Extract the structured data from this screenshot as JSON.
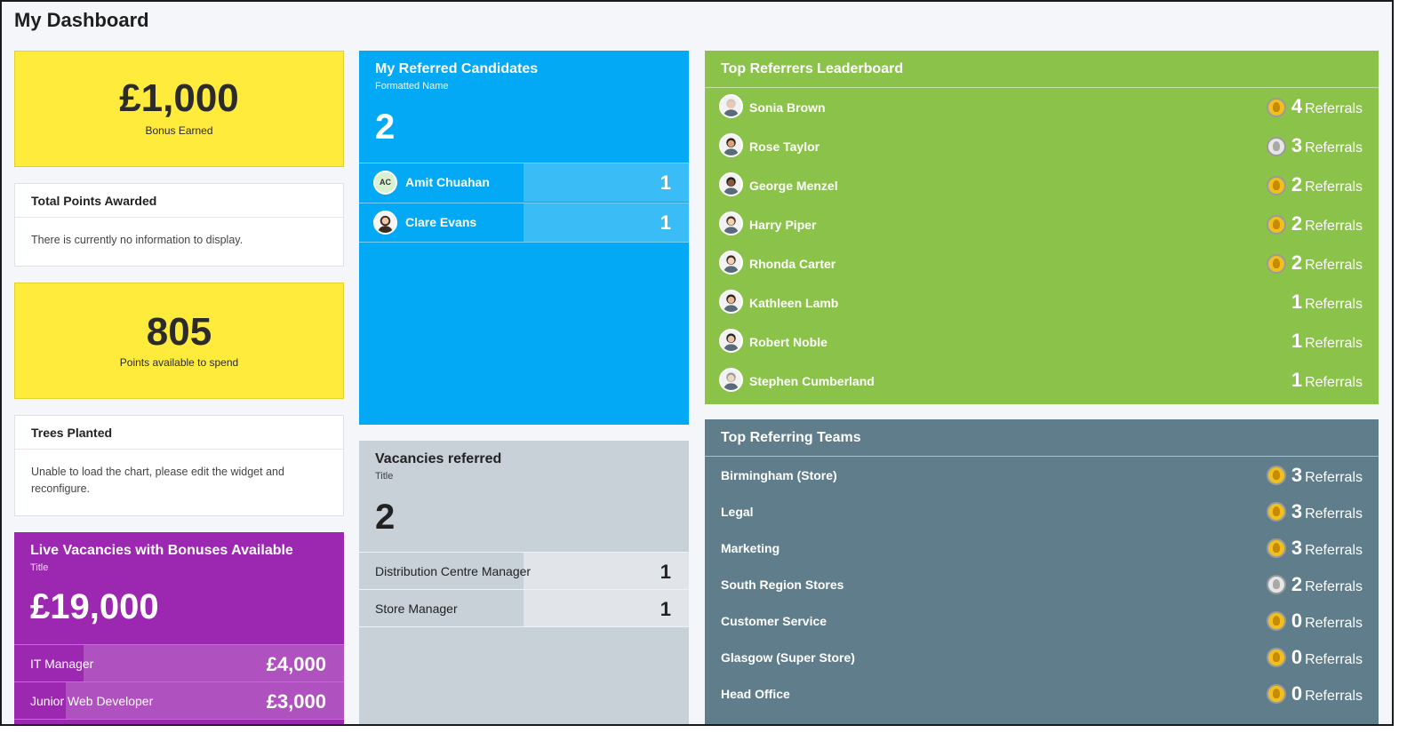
{
  "page": {
    "title": "My Dashboard"
  },
  "bonus": {
    "value": "£1,000",
    "label": "Bonus Earned"
  },
  "total_points": {
    "title": "Total Points Awarded",
    "message": "There is currently no information to display."
  },
  "points": {
    "value": "805",
    "label": "Points available to spend"
  },
  "trees": {
    "title": "Trees Planted",
    "message": "Unable to load the chart, please edit the widget and reconfigure."
  },
  "live_vacancies": {
    "title": "Live Vacancies with Bonuses Available",
    "subtitle": "Title",
    "total": "£19,000",
    "rows": [
      {
        "label": "IT Manager",
        "value": "£4,000"
      },
      {
        "label": "Junior Web Developer",
        "value": "£3,000"
      }
    ]
  },
  "referred": {
    "title": "My Referred Candidates",
    "subtitle": "Formatted Name",
    "total": "2",
    "rows": [
      {
        "initials": "AC",
        "name": "Amit Chuahan",
        "value": "1"
      },
      {
        "initials": "",
        "name": "Clare Evans",
        "value": "1"
      }
    ]
  },
  "vacancies_referred": {
    "title": "Vacancies referred",
    "subtitle": "Title",
    "total": "2",
    "rows": [
      {
        "label": "Distribution Centre Manager",
        "value": "1"
      },
      {
        "label": "Store Manager",
        "value": "1"
      }
    ]
  },
  "leaderboard": {
    "title": "Top Referrers Leaderboard",
    "unit": "Referrals",
    "rows": [
      {
        "name": "Sonia Brown",
        "count": "4",
        "medal": "gold"
      },
      {
        "name": "Rose Taylor",
        "count": "3",
        "medal": "silver"
      },
      {
        "name": "George Menzel",
        "count": "2",
        "medal": "gold"
      },
      {
        "name": "Harry Piper",
        "count": "2",
        "medal": "gold"
      },
      {
        "name": "Rhonda Carter",
        "count": "2",
        "medal": "gold"
      },
      {
        "name": "Kathleen Lamb",
        "count": "1",
        "medal": ""
      },
      {
        "name": "Robert Noble",
        "count": "1",
        "medal": ""
      },
      {
        "name": "Stephen Cumberland",
        "count": "1",
        "medal": ""
      }
    ]
  },
  "teams": {
    "title": "Top Referring Teams",
    "unit": "Referrals",
    "rows": [
      {
        "name": "Birmingham (Store)",
        "count": "3",
        "medal": "gold"
      },
      {
        "name": "Legal",
        "count": "3",
        "medal": "gold"
      },
      {
        "name": "Marketing",
        "count": "3",
        "medal": "gold"
      },
      {
        "name": "South Region Stores",
        "count": "2",
        "medal": "silver"
      },
      {
        "name": "Customer Service",
        "count": "0",
        "medal": "gold"
      },
      {
        "name": "Glasgow (Super Store)",
        "count": "0",
        "medal": "gold"
      },
      {
        "name": "Head Office",
        "count": "0",
        "medal": "gold"
      }
    ]
  }
}
